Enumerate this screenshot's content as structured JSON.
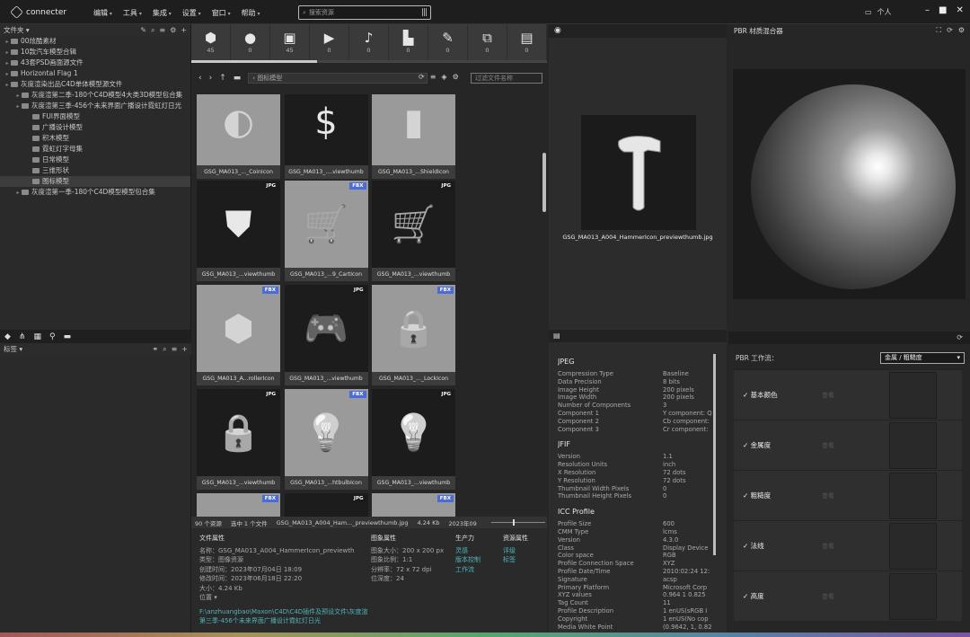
{
  "app": {
    "name": "connecter"
  },
  "menu": [
    "编辑",
    "工具",
    "集成",
    "设置",
    "窗口",
    "帮助"
  ],
  "search": {
    "placeholder": "搜索资源"
  },
  "user": {
    "label": "个人"
  },
  "folders": {
    "header": "文件夹",
    "items": [
      {
        "label": "00炫酷素材",
        "indent": 0,
        "selected": false
      },
      {
        "label": "10款汽车模型合辑",
        "indent": 0,
        "selected": false
      },
      {
        "label": "43套PSD画面源文件",
        "indent": 0,
        "selected": false
      },
      {
        "label": "Horizontal Flag 1",
        "indent": 0,
        "selected": false
      },
      {
        "label": "灰度渲染出品C4D单体模型源文件",
        "indent": 0,
        "selected": false
      },
      {
        "label": "灰度渲第二季-180个C4D模型4大类3D模型包合集",
        "indent": 1,
        "selected": false
      },
      {
        "label": "灰度渲第三季-456个未来界面广播设计霓虹灯日光",
        "indent": 1,
        "selected": false
      },
      {
        "label": "FUI界面模型",
        "indent": 2,
        "selected": false
      },
      {
        "label": "广播设计模型",
        "indent": 2,
        "selected": false
      },
      {
        "label": "积木模型",
        "indent": 2,
        "selected": false
      },
      {
        "label": "霓虹灯字母集",
        "indent": 2,
        "selected": false
      },
      {
        "label": "日常模型",
        "indent": 2,
        "selected": false
      },
      {
        "label": "三维形状",
        "indent": 2,
        "selected": false
      },
      {
        "label": "图标模型",
        "indent": 2,
        "selected": true
      },
      {
        "label": "灰度渲第一季-180个C4D模型模型包合集",
        "indent": 1,
        "selected": false
      }
    ]
  },
  "tags": {
    "header": "标签"
  },
  "typebar": [
    {
      "icon": "cube-icon",
      "glyph": "⬢",
      "count": "45"
    },
    {
      "icon": "sphere-icon",
      "glyph": "●",
      "count": "0"
    },
    {
      "icon": "image-icon",
      "glyph": "▣",
      "count": "45"
    },
    {
      "icon": "video-icon",
      "glyph": "▶",
      "count": "0"
    },
    {
      "icon": "audio-icon",
      "glyph": "♪",
      "count": "0"
    },
    {
      "icon": "chart-icon",
      "glyph": "▙",
      "count": "0"
    },
    {
      "icon": "vector-icon",
      "glyph": "✎",
      "count": "0"
    },
    {
      "icon": "code-icon",
      "glyph": "⧉",
      "count": "0"
    },
    {
      "icon": "document-icon",
      "glyph": "▤",
      "count": "0"
    }
  ],
  "nav": {
    "path": "图标模型",
    "filter_placeholder": "过滤文件名称"
  },
  "thumbs": [
    {
      "caption": "GSG_MA013_..._CoinIcon",
      "badge": "",
      "tone": "light",
      "glyph": "◐"
    },
    {
      "caption": "GSG_MA013_....viewthumb",
      "badge": "",
      "tone": "dark",
      "glyph": "$"
    },
    {
      "caption": "GSG_MA013_...ShieldIcon",
      "badge": "",
      "tone": "light",
      "glyph": "▮"
    },
    {
      "caption": "GSG_MA013_...viewthumb",
      "badge": "JPG",
      "tone": "dark",
      "glyph": "⛊"
    },
    {
      "caption": "GSG_MA013_...9_CartIcon",
      "badge": "FBX",
      "tone": "light",
      "glyph": "🛒"
    },
    {
      "caption": "GSG_MA013_...viewthumb",
      "badge": "JPG",
      "tone": "dark",
      "glyph": "🛒"
    },
    {
      "caption": "GSG_MA013_A...rollerIcon",
      "badge": "FBX",
      "tone": "light",
      "glyph": "⬢"
    },
    {
      "caption": "GSG_MA013_...viewthumb",
      "badge": "JPG",
      "tone": "dark",
      "glyph": "🎮"
    },
    {
      "caption": "GSG_MA013_..._LockIcon",
      "badge": "FBX",
      "tone": "light",
      "glyph": "🔒"
    },
    {
      "caption": "GSG_MA013_...viewthumb",
      "badge": "JPG",
      "tone": "dark",
      "glyph": "🔒"
    },
    {
      "caption": "GSG_MA013_...htbulbIcon",
      "badge": "FBX",
      "tone": "light",
      "glyph": "💡"
    },
    {
      "caption": "GSG_MA013_...viewthumb",
      "badge": "JPG",
      "tone": "dark",
      "glyph": "💡"
    },
    {
      "caption": "",
      "badge": "FBX",
      "tone": "light",
      "glyph": ""
    },
    {
      "caption": "",
      "badge": "JPG",
      "tone": "dark",
      "glyph": ""
    },
    {
      "caption": "",
      "badge": "FBX",
      "tone": "light",
      "glyph": ""
    }
  ],
  "status": {
    "count": "90 个资源",
    "selected": "选中 1 个文件",
    "filename": "GSG_MA013_A004_Ham..._previewthumb.jpg",
    "size": "4.24 Kb",
    "date": "2023年09"
  },
  "fileinfo": {
    "col1_head": "文件属性",
    "col1": [
      "名称：GSG_MA013_A004_HammerIcon_previewth",
      "类型：图像资源",
      "创建时间：2023年07月04日 18:09",
      "修改时间：2023年06月18日 22:20",
      "大小：4.24 Kb",
      "位置 ▾"
    ],
    "path": "F:\\anzhuangbao\\Maxon\\C4D\\C4D插件及预设文件\\灰度渲第三季-456个未来界面广播设计霓虹灯日光",
    "col2_head": "图象属性",
    "col2": [
      "图象大小：200 x 200 px",
      "图象比例：1:1",
      "分辨率：72 x 72 dpi",
      "位深度：24"
    ],
    "col3_head": "生产力",
    "col3": [
      "灵感",
      "版本控制",
      "工作流"
    ],
    "col4_head": "资源属性",
    "col4": [
      "评级",
      "标签"
    ]
  },
  "preview": {
    "filename": "GSG_MA013_A004_HammerIcon_previewthumb.jpg"
  },
  "meta": {
    "sections": [
      {
        "title": "JPEG",
        "rows": [
          [
            "Compression Type",
            "Baseline"
          ],
          [
            "Data Precision",
            "8 bits"
          ],
          [
            "Image Height",
            "200 pixels"
          ],
          [
            "Image Width",
            "200 pixels"
          ],
          [
            "Number of Components",
            "3"
          ],
          [
            "Component 1",
            "Y component: Q"
          ],
          [
            "Component 2",
            "Cb component:"
          ],
          [
            "Component 3",
            "Cr component:"
          ]
        ]
      },
      {
        "title": "JFIF",
        "rows": [
          [
            "Version",
            "1.1"
          ],
          [
            "Resolution Units",
            "inch"
          ],
          [
            "X Resolution",
            "72 dots"
          ],
          [
            "Y Resolution",
            "72 dots"
          ],
          [
            "Thumbnail Width Pixels",
            "0"
          ],
          [
            "Thumbnail Height Pixels",
            "0"
          ]
        ]
      },
      {
        "title": "ICC Profile",
        "rows": [
          [
            "Profile Size",
            "600"
          ],
          [
            "CMM Type",
            "lcms"
          ],
          [
            "Version",
            "4.3.0"
          ],
          [
            "Class",
            "Display Device"
          ],
          [
            "Color space",
            "RGB"
          ],
          [
            "Profile Connection Space",
            "XYZ"
          ],
          [
            "Profile Date/Time",
            "2010:02:24 12:"
          ],
          [
            "Signature",
            "acsp"
          ],
          [
            "Primary Platform",
            "Microsoft Corp"
          ],
          [
            "XYZ values",
            "0.964 1 0.825"
          ],
          [
            "Tag Count",
            "11"
          ],
          [
            "Profile Description",
            "1 enUS(sRGB I"
          ],
          [
            "Copyright",
            "1 enUS(No cop"
          ],
          [
            "Media White Point",
            "(0.9642, 1, 0.82"
          ]
        ]
      }
    ]
  },
  "pbr": {
    "title": "PBR 材质混合器",
    "workflow_label": "PBR 工作流：",
    "workflow_value": "金属 / 粗糙度",
    "view_label": "查看",
    "channels": [
      "基本颜色",
      "金属度",
      "粗糙度",
      "法线",
      "高度"
    ]
  }
}
